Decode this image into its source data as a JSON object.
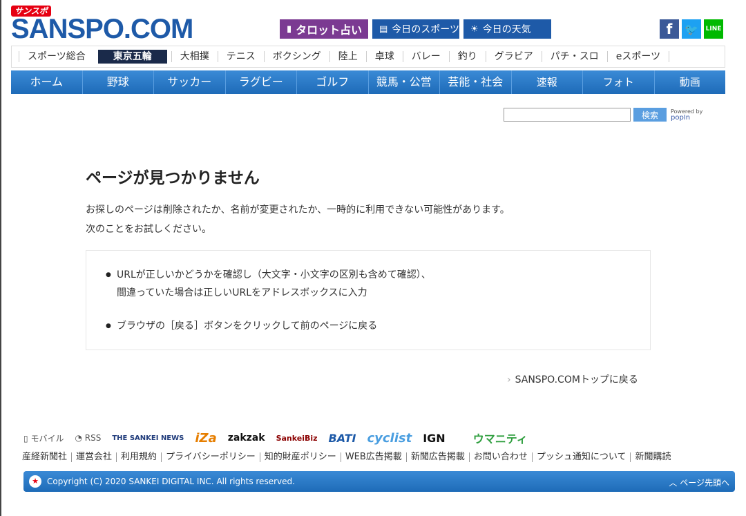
{
  "header": {
    "logo_sub": "サンスポ",
    "logo_main": "SANSPO.COM",
    "tarot": "タロット占い",
    "today_sports": "今日のスポーツ",
    "today_weather": "今日の天気",
    "facebook": "f",
    "twitter": "t",
    "line": "LINE"
  },
  "categories": [
    "スポーツ総合",
    "東京五輪",
    "大相撲",
    "テニス",
    "ボクシング",
    "陸上",
    "卓球",
    "バレー",
    "釣り",
    "グラビア",
    "パチ・スロ",
    "eスポーツ"
  ],
  "nav": [
    "ホーム",
    "野球",
    "サッカー",
    "ラグビー",
    "ゴルフ",
    "競馬・公営",
    "芸能・社会",
    "速報",
    "フォト",
    "動画"
  ],
  "search": {
    "placeholder": "",
    "button": "検索",
    "powered_by": "Powered by",
    "popin": "popIn"
  },
  "content": {
    "title": "ページが見つかりません",
    "desc_line1": "お探しのページは削除されたか、名前が変更されたか、一時的に利用できない可能性があります。",
    "desc_line2": "次のことをお試しください。",
    "tip1_line1": "URLが正しいかどうかを確認し（大文字・小文字の区別も含めて確認）、",
    "tip1_line2": "間違っていた場合は正しいURLをアドレスボックスに入力",
    "tip2": "ブラウザの［戻る］ボタンをクリックして前のページに戻る",
    "back_link": "SANSPO.COMトップに戻る"
  },
  "footer": {
    "mobile": "モバイル",
    "rss": "RSS",
    "logos": {
      "sankei_news": "THE SANKEI NEWS",
      "iza": "iZa",
      "zakzak": "zakzak",
      "sankeibiz": "SankeiBiz",
      "bati": "BATI",
      "cyclist": "cyclist",
      "ign": "IGN",
      "umaniti": "ウマニティ"
    },
    "links": [
      "産経新聞社",
      "運営会社",
      "利用規約",
      "プライバシーポリシー",
      "知的財産ポリシー",
      "WEB広告掲載",
      "新聞広告掲載",
      "お問い合わせ",
      "プッシュ通知について",
      "新聞購読"
    ],
    "copyright": "Copyright (C) 2020 SANKEI DIGITAL INC. All rights reserved.",
    "page_top": "ページ先頭へ"
  }
}
